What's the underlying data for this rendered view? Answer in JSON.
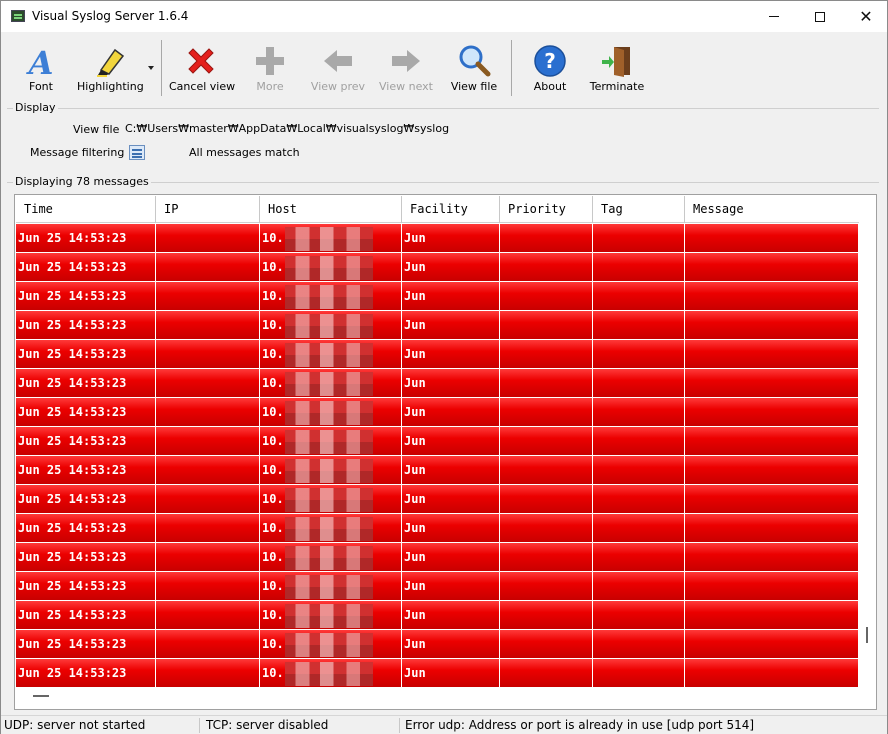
{
  "window": {
    "title": "Visual Syslog Server 1.6.4"
  },
  "toolbar": {
    "font": "Font",
    "highlighting": "Highlighting",
    "cancel_view": "Cancel view",
    "more": "More",
    "view_prev": "View prev",
    "view_next": "View next",
    "view_file": "View file",
    "about": "About",
    "terminate": "Terminate"
  },
  "display": {
    "group_title": "Display",
    "view_file_label": "View file",
    "view_file_path": "C:₩Users₩master₩AppData₩Local₩visualsyslog₩syslog",
    "filter_label": "Message filtering",
    "filter_value": "All messages match"
  },
  "messages": {
    "group_title": "Displaying 78 messages",
    "columns": [
      "Time",
      "IP",
      "Host",
      "Facility",
      "Priority",
      "Tag",
      "Message"
    ],
    "rows": [
      {
        "time": "Jun 25 14:53:23",
        "ip": "",
        "host": "10.",
        "facility": "Jun",
        "priority": "",
        "tag": "",
        "message": ""
      },
      {
        "time": "Jun 25 14:53:23",
        "ip": "",
        "host": "10.",
        "facility": "Jun",
        "priority": "",
        "tag": "",
        "message": ""
      },
      {
        "time": "Jun 25 14:53:23",
        "ip": "",
        "host": "10.",
        "facility": "Jun",
        "priority": "",
        "tag": "",
        "message": ""
      },
      {
        "time": "Jun 25 14:53:23",
        "ip": "",
        "host": "10.",
        "facility": "Jun",
        "priority": "",
        "tag": "",
        "message": ""
      },
      {
        "time": "Jun 25 14:53:23",
        "ip": "",
        "host": "10.",
        "facility": "Jun",
        "priority": "",
        "tag": "",
        "message": ""
      },
      {
        "time": "Jun 25 14:53:23",
        "ip": "",
        "host": "10.",
        "facility": "Jun",
        "priority": "",
        "tag": "",
        "message": ""
      },
      {
        "time": "Jun 25 14:53:23",
        "ip": "",
        "host": "10.",
        "facility": "Jun",
        "priority": "",
        "tag": "",
        "message": ""
      },
      {
        "time": "Jun 25 14:53:23",
        "ip": "",
        "host": "10.",
        "facility": "Jun",
        "priority": "",
        "tag": "",
        "message": ""
      },
      {
        "time": "Jun 25 14:53:23",
        "ip": "",
        "host": "10.",
        "facility": "Jun",
        "priority": "",
        "tag": "",
        "message": ""
      },
      {
        "time": "Jun 25 14:53:23",
        "ip": "",
        "host": "10.",
        "facility": "Jun",
        "priority": "",
        "tag": "",
        "message": ""
      },
      {
        "time": "Jun 25 14:53:23",
        "ip": "",
        "host": "10.",
        "facility": "Jun",
        "priority": "",
        "tag": "",
        "message": ""
      },
      {
        "time": "Jun 25 14:53:23",
        "ip": "",
        "host": "10.",
        "facility": "Jun",
        "priority": "",
        "tag": "",
        "message": ""
      },
      {
        "time": "Jun 25 14:53:23",
        "ip": "",
        "host": "10.",
        "facility": "Jun",
        "priority": "",
        "tag": "",
        "message": ""
      },
      {
        "time": "Jun 25 14:53:23",
        "ip": "",
        "host": "10.",
        "facility": "Jun",
        "priority": "",
        "tag": "",
        "message": ""
      },
      {
        "time": "Jun 25 14:53:23",
        "ip": "",
        "host": "10.",
        "facility": "Jun",
        "priority": "",
        "tag": "",
        "message": ""
      },
      {
        "time": "Jun 25 14:53:23",
        "ip": "",
        "host": "10.",
        "facility": "Jun",
        "priority": "",
        "tag": "",
        "message": ""
      }
    ]
  },
  "status": {
    "udp": "UDP: server not started",
    "tcp": "TCP: server disabled",
    "error": "Error udp: Address or port is already in use [udp port 514]"
  },
  "colors": {
    "row_red": "#e60000",
    "accent_blue": "#2a6fd0"
  },
  "icons": [
    "app-icon",
    "font-icon",
    "highlighter-icon",
    "cancel-x-icon",
    "plus-icon",
    "arrow-left-icon",
    "arrow-right-icon",
    "magnifier-icon",
    "help-icon",
    "exit-door-icon",
    "filter-icon"
  ]
}
